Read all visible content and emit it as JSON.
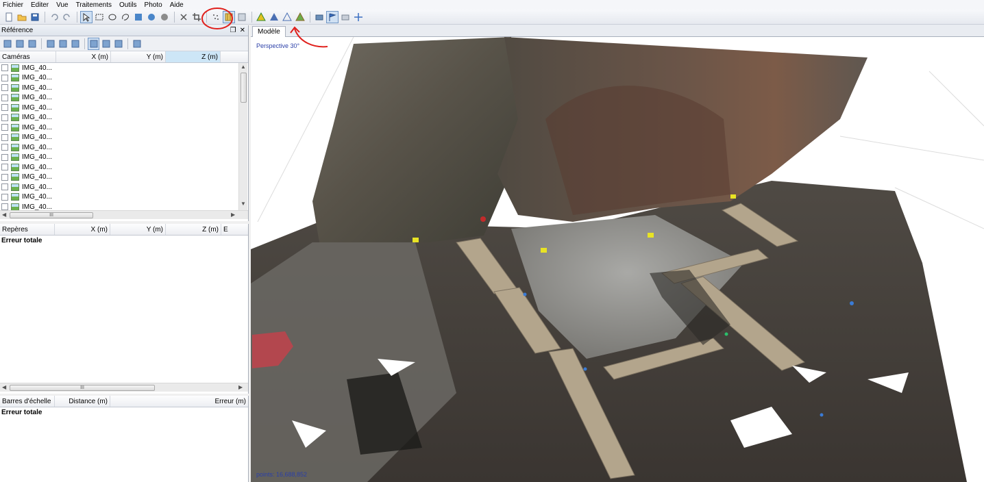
{
  "menu": [
    "Fichier",
    "Editer",
    "Vue",
    "Traitements",
    "Outils",
    "Photo",
    "Aide"
  ],
  "toolbar_icons": [
    "new-file-icon",
    "open-folder-icon",
    "save-icon",
    "|",
    "undo-icon",
    "redo-icon",
    "|",
    "pointer-select-icon",
    "rectangle-select-icon",
    "ellipse-select-icon",
    "free-select-icon",
    "reset-selection-icon",
    "shrink-icon",
    "expand-icon",
    "|",
    "delete-icon",
    "crop-icon",
    "|",
    "point-cloud-icon",
    "dense-cloud-icon",
    "dense-cloud-classes-icon",
    "|",
    "solid-model-icon",
    "shaded-model-icon",
    "wireframe-model-icon",
    "textured-model-icon",
    "|",
    "show-cameras-icon",
    "show-markers-icon",
    "show-region-icon",
    "navigation-icon"
  ],
  "colors": {
    "annotation": "#e0201c",
    "overlay_text": "#2a3fa8",
    "sorted_column": "#cde6f7"
  },
  "reference_panel": {
    "title": "Référence",
    "tool_icons": [
      "import-icon",
      "export-icon",
      "save-reference-icon",
      "|",
      "settings-icon",
      "wand-icon",
      "update-icon",
      "|",
      "view-source-icon",
      "view-estimated-icon",
      "view-errors-icon",
      "|",
      "reference-settings-icon"
    ],
    "cameras": {
      "columns": [
        "Caméras",
        "X (m)",
        "Y (m)",
        "Z (m)"
      ],
      "rows": [
        "IMG_40...",
        "IMG_40...",
        "IMG_40...",
        "IMG_40...",
        "IMG_40...",
        "IMG_40...",
        "IMG_40...",
        "IMG_40...",
        "IMG_40...",
        "IMG_40...",
        "IMG_40...",
        "IMG_40...",
        "IMG_40...",
        "IMG_40...",
        "IMG_40...",
        "IMG_40..."
      ],
      "scroll_thumb": "III"
    },
    "markers": {
      "columns": [
        "Repères",
        "X (m)",
        "Y (m)",
        "Z (m)",
        "E"
      ],
      "total": "Erreur totale",
      "scroll_thumb": "III"
    },
    "scalebars": {
      "columns": [
        "Barres d'échelle",
        "Distance (m)",
        "Erreur (m)"
      ],
      "total": "Erreur totale"
    }
  },
  "model": {
    "tab": "Modèle",
    "perspective": "Perspective 30°",
    "points": "points: 16,688,852"
  }
}
